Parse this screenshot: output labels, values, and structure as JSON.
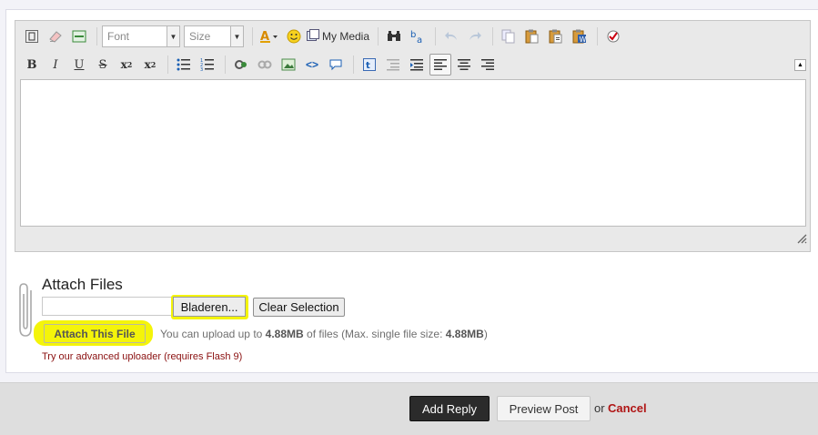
{
  "toolbar": {
    "font_placeholder": "Font",
    "size_placeholder": "Size",
    "my_media_label": "My Media"
  },
  "attach": {
    "title": "Attach Files",
    "browse_label": "Bladeren...",
    "clear_label": "Clear Selection",
    "attach_button_label": "Attach This File",
    "upload_prefix": "You can upload up to",
    "upload_limit": "4.88MB",
    "upload_middle": "of files (Max. single file size:",
    "single_limit": "4.88MB",
    "upload_suffix": ")",
    "advanced_link": "Try our advanced uploader (requires Flash 9)"
  },
  "actions": {
    "add_reply": "Add Reply",
    "preview_post": "Preview Post",
    "or_text": "or",
    "cancel": "Cancel"
  },
  "colors": {
    "highlight": "#f4f40a",
    "cancel": "#b01515",
    "link": "#8a1010",
    "primary_button": "#2b2b2b"
  }
}
